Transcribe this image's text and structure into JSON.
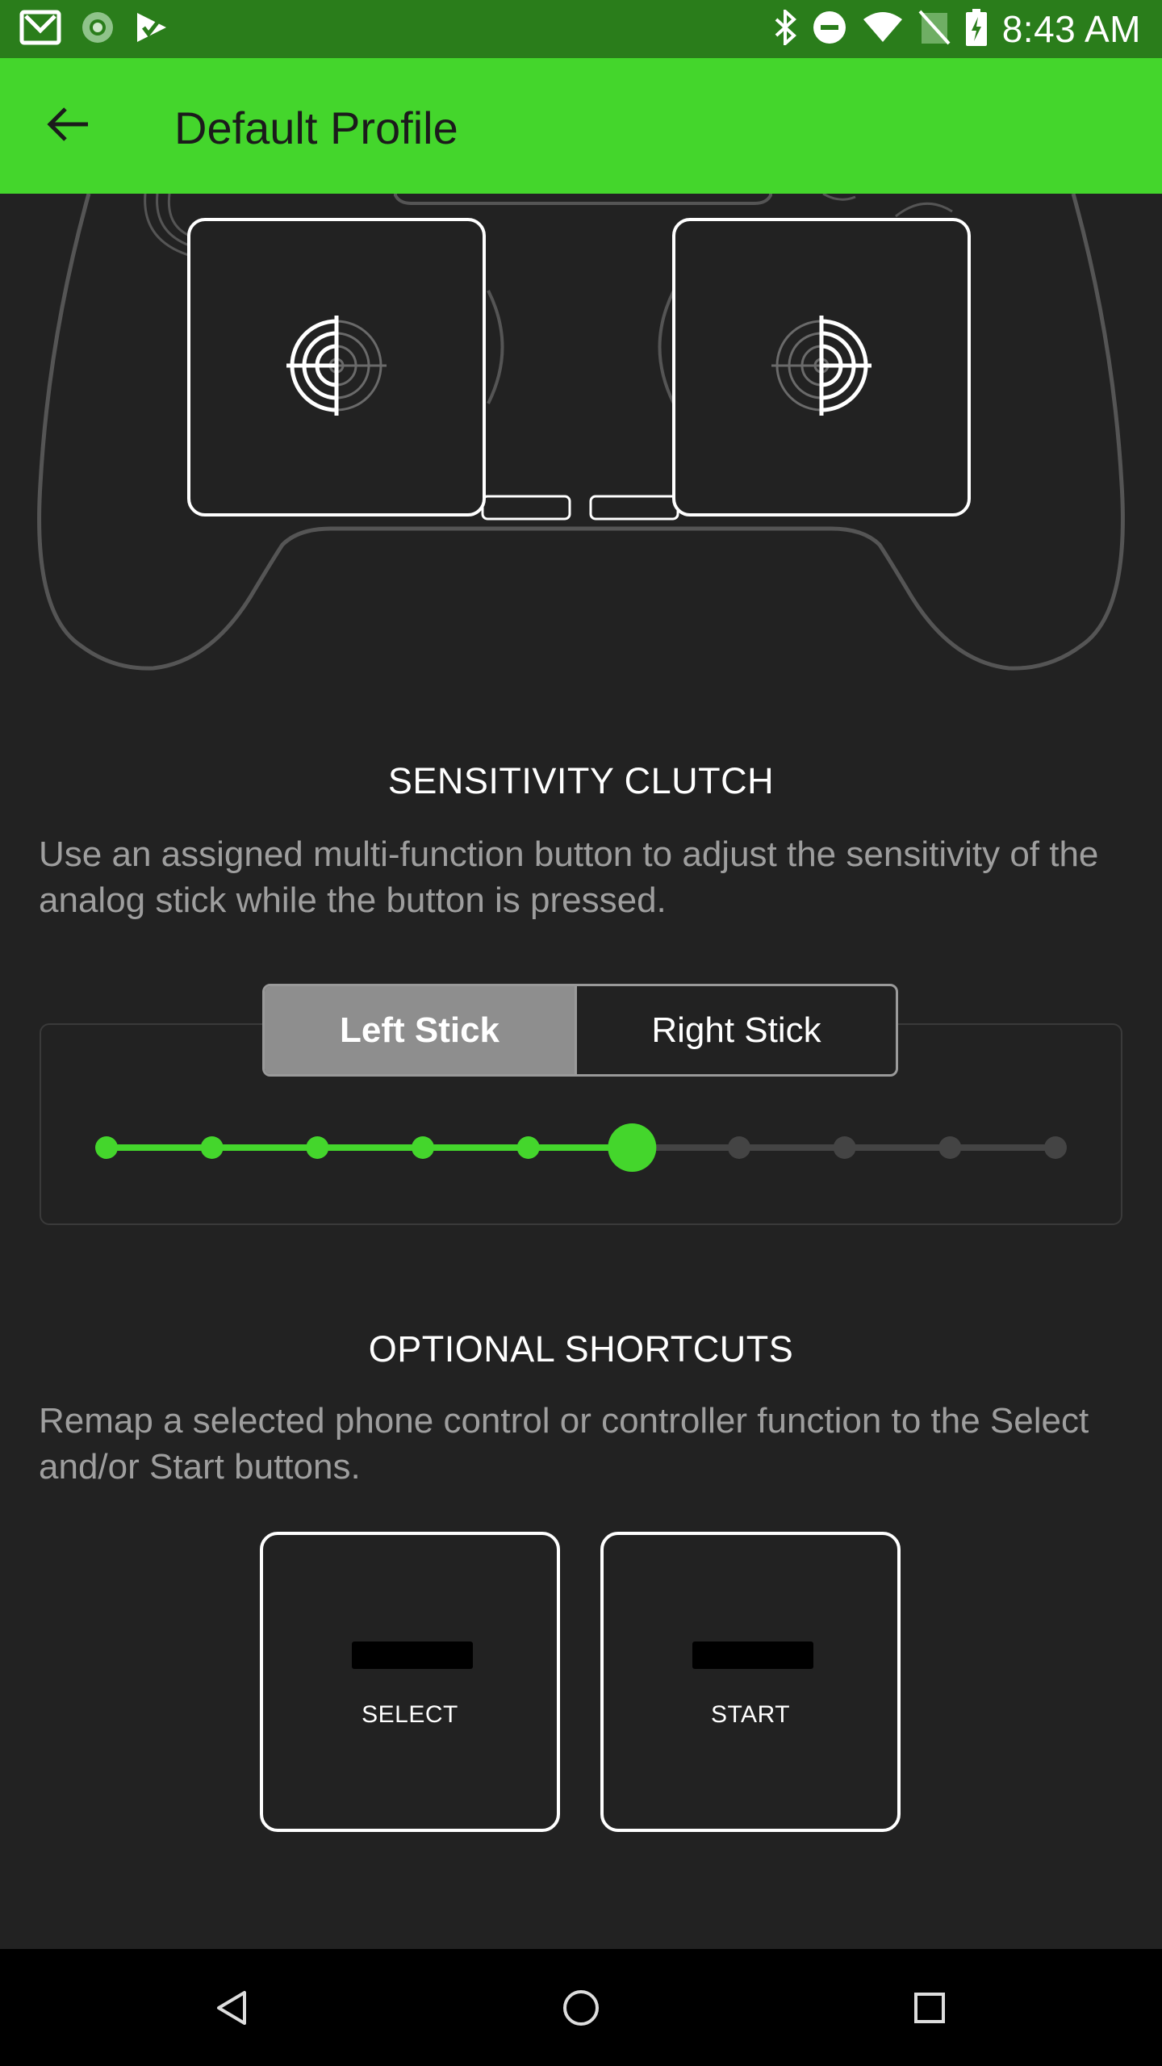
{
  "status_bar": {
    "time": "8:43 AM",
    "left_icons": [
      "gmail-icon",
      "sync-icon",
      "play-store-icon"
    ],
    "right_icons": [
      "bluetooth-icon",
      "do-not-disturb-icon",
      "wifi-icon",
      "no-sim-icon",
      "battery-charging-icon"
    ]
  },
  "app_bar": {
    "title": "Default Profile",
    "back_icon": "arrow-left-icon"
  },
  "controller": {
    "left_stick_icon": "crosshair-left-icon",
    "right_stick_icon": "crosshair-right-icon"
  },
  "sensitivity": {
    "title": "SENSITIVITY CLUTCH",
    "description": "Use an assigned multi-function button to adjust the sensitivity of the analog stick while the button is pressed.",
    "tabs": [
      {
        "label": "Left Stick",
        "selected": true
      },
      {
        "label": "Right Stick",
        "selected": false
      }
    ],
    "slider": {
      "steps": 10,
      "selected_index": 5,
      "active_color": "#44d62c",
      "inactive_color": "#444444"
    }
  },
  "shortcuts": {
    "title": "OPTIONAL SHORTCUTS",
    "description": "Remap a selected phone control or controller function to the Select and/or Start buttons.",
    "select_label": "SELECT",
    "start_label": "START"
  },
  "colors": {
    "status_bar": "#2a7d1b",
    "app_bar": "#44d62c",
    "background": "#222222",
    "accent": "#44d62c"
  },
  "nav_bar": {
    "icons": [
      "back-triangle-icon",
      "home-circle-icon",
      "recents-square-icon"
    ]
  }
}
